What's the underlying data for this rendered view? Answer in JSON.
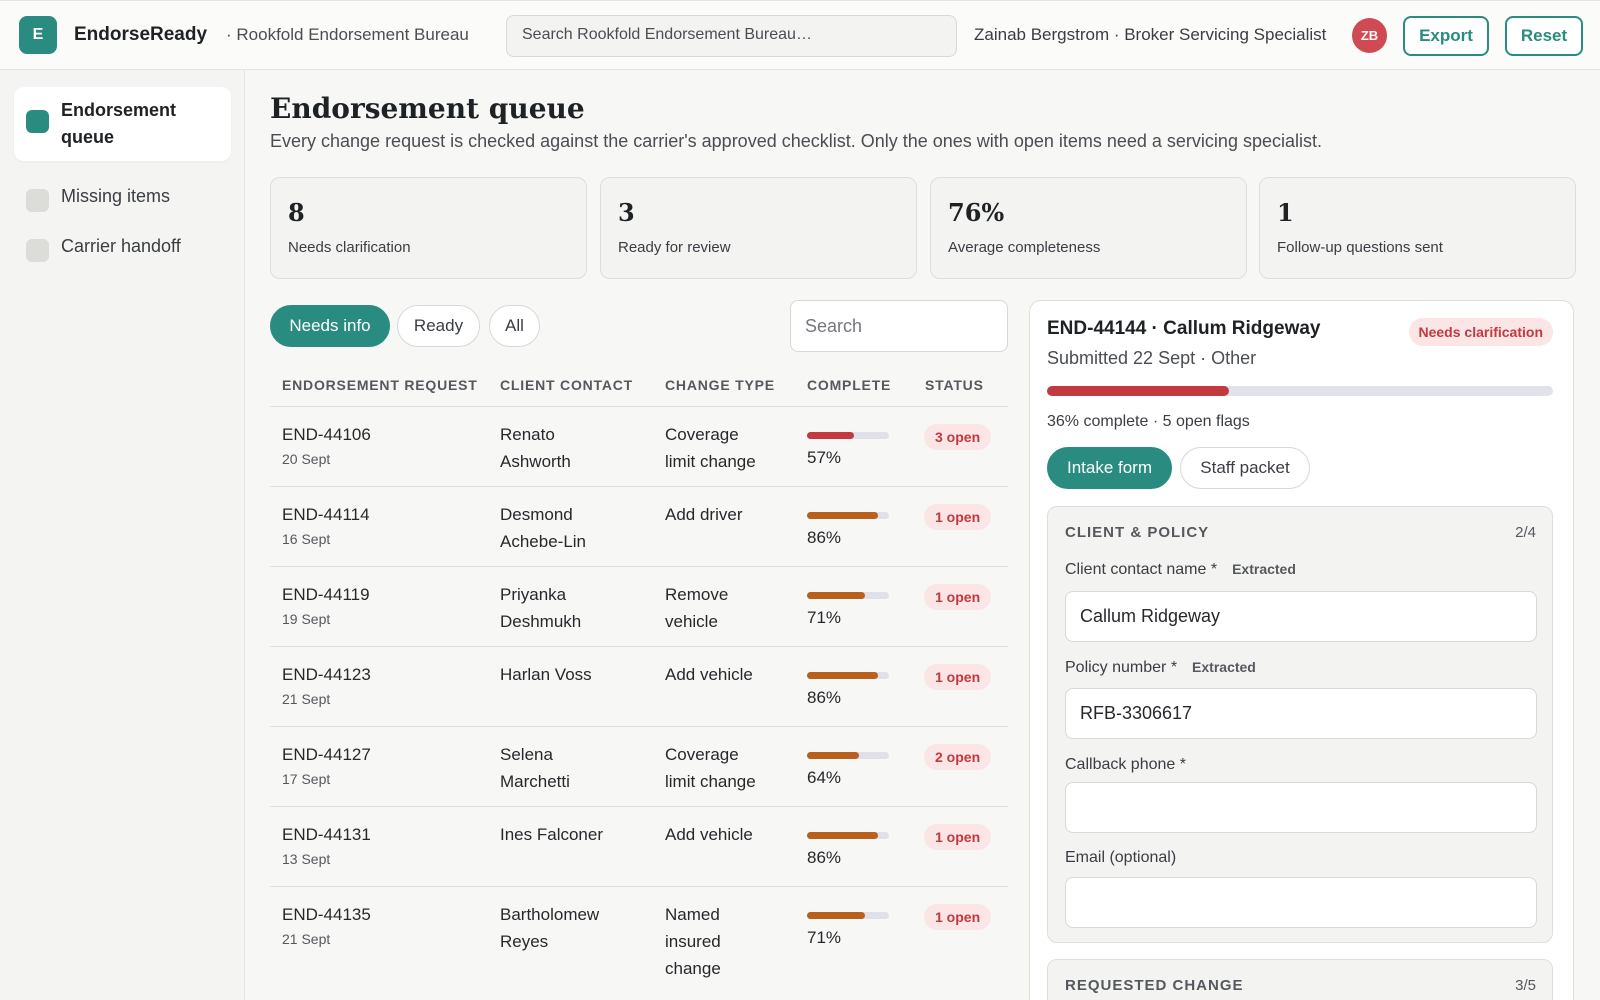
{
  "app": {
    "logo_letter": "E",
    "name": "EndorseReady",
    "org": "· Rookfold Endorsement Bureau",
    "search_placeholder": "Search Rookfold Endorsement Bureau…",
    "user": "Zainab Bergstrom · Broker Servicing Specialist",
    "avatar_initials": "ZB",
    "export_label": "Export",
    "reset_label": "Reset"
  },
  "sidebar": {
    "items": [
      {
        "label": "Endorsement queue",
        "active": true
      },
      {
        "label": "Missing items",
        "active": false
      },
      {
        "label": "Carrier handoff",
        "active": false
      }
    ]
  },
  "main": {
    "title": "Endorsement queue",
    "subtitle": "Every change request is checked against the carrier's approved checklist. Only the ones with open items need a servicing specialist.",
    "stats": [
      {
        "value": "8",
        "label": "Needs clarification"
      },
      {
        "value": "3",
        "label": "Ready for review"
      },
      {
        "value": "76%",
        "label": "Average completeness"
      },
      {
        "value": "1",
        "label": "Follow-up questions sent"
      }
    ],
    "filters": [
      "Needs info",
      "Ready",
      "All"
    ],
    "search_placeholder": "Search",
    "columns": [
      "ENDORSEMENT REQUEST",
      "CLIENT CONTACT",
      "CHANGE TYPE",
      "COMPLETE",
      "STATUS"
    ],
    "rows": [
      {
        "id": "END-44106",
        "date": "20 Sept",
        "contact": [
          "Renato",
          "Ashworth"
        ],
        "change": [
          "Coverage",
          "limit change"
        ],
        "complete": 57,
        "complete_label": "57%",
        "status": "3 open"
      },
      {
        "id": "END-44114",
        "date": "16 Sept",
        "contact": [
          "Desmond",
          "Achebe-Lin"
        ],
        "change": [
          "Add driver"
        ],
        "complete": 86,
        "complete_label": "86%",
        "status": "1 open"
      },
      {
        "id": "END-44119",
        "date": "19 Sept",
        "contact": [
          "Priyanka",
          "Deshmukh"
        ],
        "change": [
          "Remove",
          "vehicle"
        ],
        "complete": 71,
        "complete_label": "71%",
        "status": "1 open"
      },
      {
        "id": "END-44123",
        "date": "21 Sept",
        "contact": [
          "Harlan Voss"
        ],
        "change": [
          "Add vehicle"
        ],
        "complete": 86,
        "complete_label": "86%",
        "status": "1 open"
      },
      {
        "id": "END-44127",
        "date": "17 Sept",
        "contact": [
          "Selena",
          "Marchetti"
        ],
        "change": [
          "Coverage",
          "limit change"
        ],
        "complete": 64,
        "complete_label": "64%",
        "status": "2 open"
      },
      {
        "id": "END-44131",
        "date": "13 Sept",
        "contact": [
          "Ines Falconer"
        ],
        "change": [
          "Add vehicle"
        ],
        "complete": 86,
        "complete_label": "86%",
        "status": "1 open"
      },
      {
        "id": "END-44135",
        "date": "21 Sept",
        "contact": [
          "Bartholomew",
          "Reyes"
        ],
        "change": [
          "Named",
          "insured",
          "change"
        ],
        "complete": 71,
        "complete_label": "71%",
        "status": "1 open"
      }
    ]
  },
  "detail": {
    "title": "END-44144 · Callum Ridgeway",
    "badge": "Needs clarification",
    "submitted": "Submitted 22 Sept · Other",
    "complete": 36,
    "progress_text": "36% complete · 5 open flags",
    "tabs": [
      "Intake form",
      "Staff packet"
    ],
    "sections": [
      {
        "title": "CLIENT & POLICY",
        "count": "2/4",
        "fields": [
          {
            "label": "Client contact name *",
            "tag": "Extracted",
            "value": "Callum Ridgeway"
          },
          {
            "label": "Policy number *",
            "tag": "Extracted",
            "value": "RFB-3306617"
          },
          {
            "label": "Callback phone *",
            "tag": "",
            "value": ""
          },
          {
            "label": "Email (optional)",
            "tag": "",
            "value": ""
          }
        ]
      },
      {
        "title": "REQUESTED CHANGE",
        "count": "3/5"
      }
    ]
  },
  "colors": {
    "accent": "#2a8c80",
    "danger": "#c23a40",
    "warning": "#b8601e"
  }
}
